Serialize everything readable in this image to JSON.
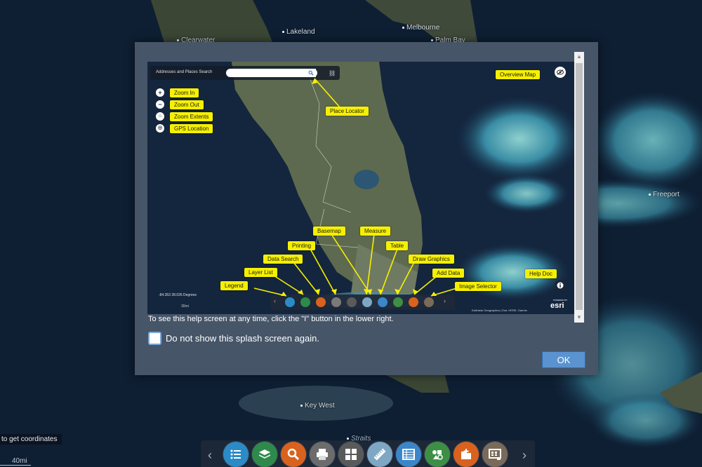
{
  "background_map": {
    "cities": [
      "Clearwater",
      "Lakeland",
      "Melbourne",
      "Palm Bay",
      "Freeport",
      "Key West",
      "Straits"
    ],
    "coords_hint": "to get coordinates",
    "scale_label": "40mi"
  },
  "toolbar": {
    "buttons": [
      {
        "icon": "legend-list-icon",
        "color": "#2b8bc6"
      },
      {
        "icon": "layers-icon",
        "color": "#2e8a4a"
      },
      {
        "icon": "search-icon",
        "color": "#d9621e"
      },
      {
        "icon": "printer-icon",
        "color": "#6c6c6c"
      },
      {
        "icon": "basemap-grid-icon",
        "color": "#5a5a5a"
      },
      {
        "icon": "measure-ruler-icon",
        "color": "#7ea7c4"
      },
      {
        "icon": "table-icon",
        "color": "#3b86c9"
      },
      {
        "icon": "draw-graphics-icon",
        "color": "#3d8f46"
      },
      {
        "icon": "add-data-icon",
        "color": "#d9621e"
      },
      {
        "icon": "image-selector-icon",
        "color": "#7a6a5a"
      }
    ]
  },
  "modal": {
    "help_text": "To see this help screen at any time, click the \"I\" button in the lower right.",
    "checkbox_label": "Do not show this splash screen again.",
    "ok_label": "OK",
    "shot": {
      "search_label": "Addresses and Places Search",
      "labels": {
        "overview_map": "Overview Map",
        "zoom_in": "Zoom In",
        "zoom_out": "Zoom Out",
        "zoom_extents": "Zoom Extents",
        "gps_location": "GPS Location",
        "place_locator": "Place Locator",
        "basemap": "Basemap",
        "measure": "Measure",
        "printing": "Printing",
        "table": "Table",
        "data_search": "Data Search",
        "draw_graphics": "Draw Graphics",
        "layer_list": "Layer List",
        "add_data": "Add Data",
        "help_doc": "Help Doc",
        "legend": "Legend",
        "image_selector": "Image Selector"
      },
      "coords": "-84.353 28.026 Degrees",
      "scale": "30mi",
      "attribution": "Earthstar Geographics | Esri, HERE, Garmin",
      "esri": "esri",
      "esri_powered": "POWERED BY"
    }
  }
}
